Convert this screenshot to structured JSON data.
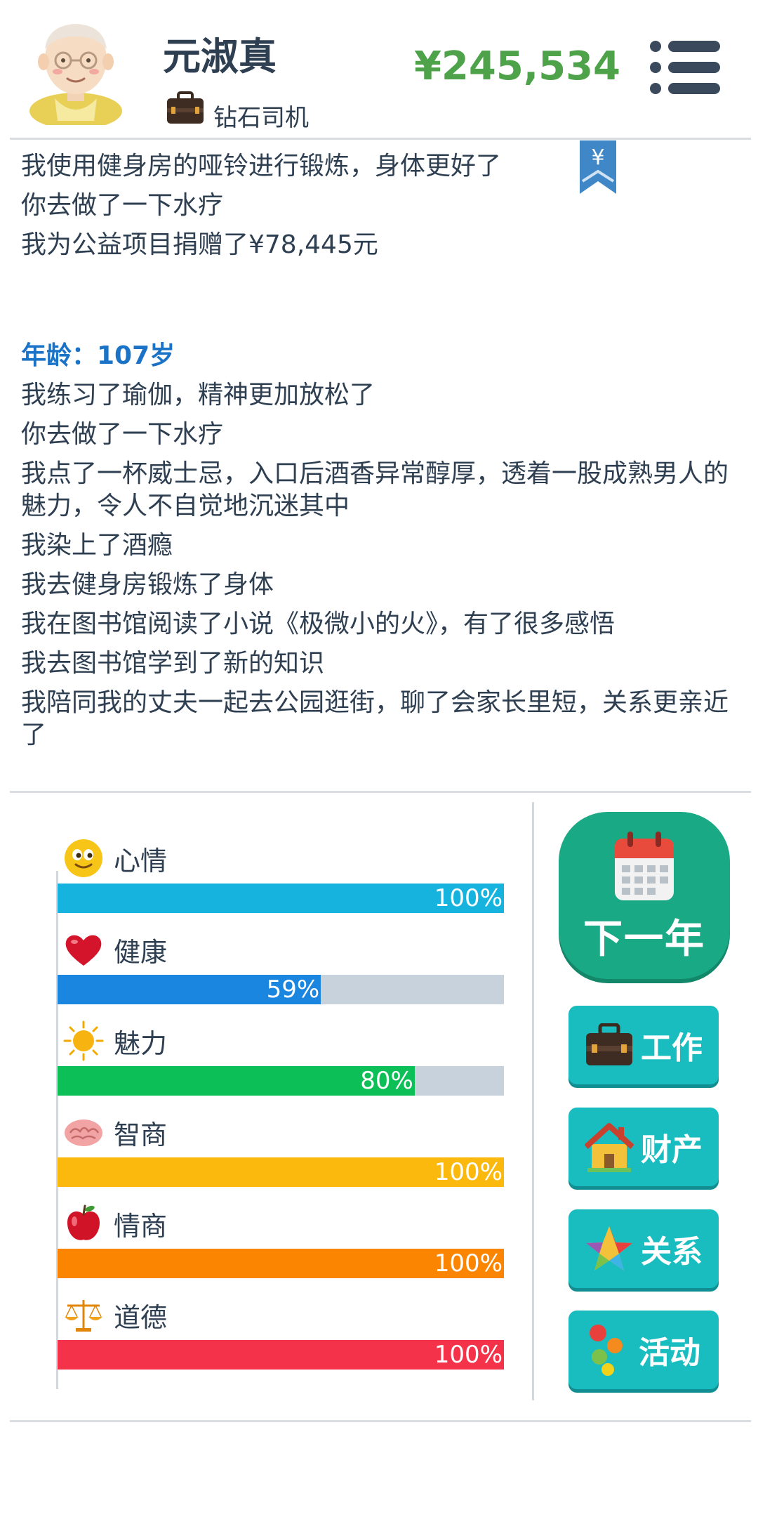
{
  "header": {
    "player_name": "元淑真",
    "job_title": "钻石司机",
    "money": "¥245,534",
    "avatar_icon": "elderly-man-avatar",
    "job_icon": "briefcase-icon",
    "menu_icon": "menu-icon"
  },
  "log": {
    "previous_lines": [
      "我使用健身房的哑铃进行锻炼，身体更好了",
      "你去做了一下水疗",
      "我为公益项目捐赠了¥78,445元"
    ],
    "bookmark_icon": "yen-bookmark-icon",
    "bookmark_symbol": "¥",
    "age_label": "年龄：107岁",
    "lines": [
      "我练习了瑜伽，精神更加放松了",
      "你去做了一下水疗",
      "我点了一杯威士忌，入口后酒香异常醇厚，透着一股成熟男人的魅力，令人不自觉地沉迷其中",
      "我染上了酒瘾",
      "我去健身房锻炼了身体",
      "我在图书馆阅读了小说《极微小的火》，有了很多感悟",
      "我去图书馆学到了新的知识",
      "我陪同我的丈夫一起去公园逛街，聊了会家长里短，关系更亲近了"
    ]
  },
  "stats": [
    {
      "label": "心情",
      "value": 100,
      "pct_text": "100%",
      "color": "#16b3df",
      "icon": "smiley-icon"
    },
    {
      "label": "健康",
      "value": 59,
      "pct_text": "59%",
      "color": "#1b86e0",
      "icon": "heart-icon"
    },
    {
      "label": "魅力",
      "value": 80,
      "pct_text": "80%",
      "color": "#0dbf57",
      "icon": "sun-icon"
    },
    {
      "label": "智商",
      "value": 100,
      "pct_text": "100%",
      "color": "#fbb80d",
      "icon": "brain-icon"
    },
    {
      "label": "情商",
      "value": 100,
      "pct_text": "100%",
      "color": "#fb8400",
      "icon": "apple-icon"
    },
    {
      "label": "道德",
      "value": 100,
      "pct_text": "100%",
      "color": "#f4324a",
      "icon": "scales-icon"
    }
  ],
  "actions": {
    "next_year": "下一年",
    "work": "工作",
    "property": "财产",
    "relations": "关系",
    "activities": "活动"
  },
  "colors": {
    "money": "#4ea24a",
    "age": "#1b73c8",
    "next_button": "#1aa985",
    "side_button": "#1abdbf",
    "bar_track": "#c8d2dd"
  }
}
